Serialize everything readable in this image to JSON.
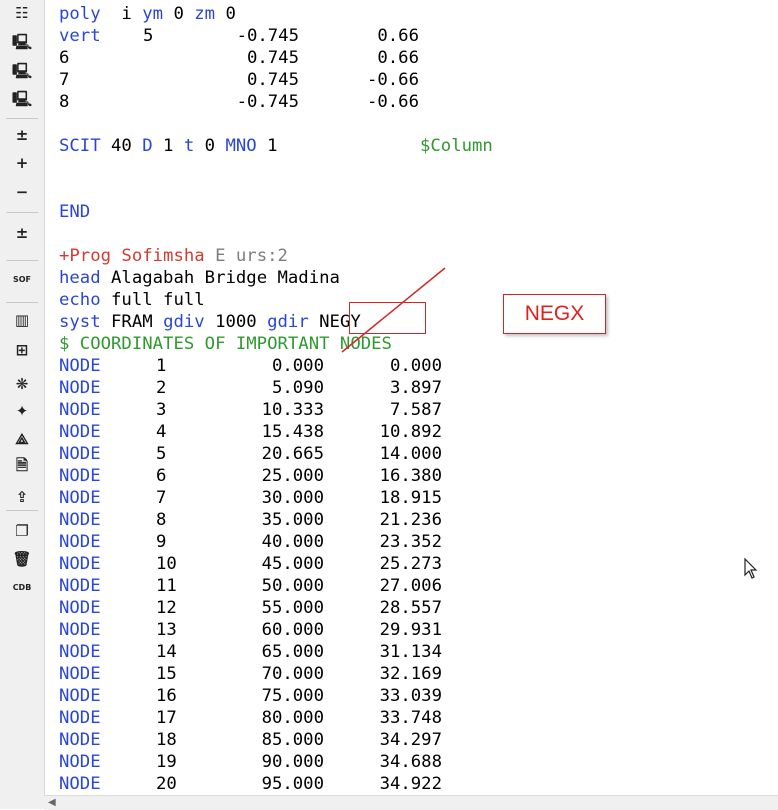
{
  "toolbar": {
    "buttons": [
      {
        "name": "list-view-icon",
        "glyph": "☷"
      },
      {
        "name": "computer-icon",
        "glyph": "🖳"
      },
      {
        "name": "computer-run-icon",
        "glyph": "🖳"
      },
      {
        "name": "computer-export-icon",
        "glyph": "🖳"
      },
      {
        "name": "plus-minus-icon",
        "glyph": "±"
      },
      {
        "name": "plus-icon",
        "glyph": "+"
      },
      {
        "name": "minus-icon",
        "glyph": "−"
      },
      {
        "name": "plus-minus-dropdown-icon",
        "glyph": "±"
      },
      {
        "name": "sofistik-icon",
        "glyph": "SOF"
      },
      {
        "name": "table-icon",
        "glyph": "▥"
      },
      {
        "name": "bridge-icon",
        "glyph": "⊞"
      },
      {
        "name": "butterfly-icon",
        "glyph": "❋"
      },
      {
        "name": "bat-icon",
        "glyph": "✦"
      },
      {
        "name": "structure-icon",
        "glyph": "⟁"
      },
      {
        "name": "document-icon",
        "glyph": "🗎"
      },
      {
        "name": "upload-icon",
        "glyph": "⇪"
      },
      {
        "name": "copy-icon",
        "glyph": "❐"
      },
      {
        "name": "trash-icon",
        "glyph": "🗑"
      },
      {
        "name": "cdb-icon",
        "glyph": "CDB"
      }
    ]
  },
  "code": {
    "poly": {
      "kw": "poly",
      "rest": "  i ",
      "ym": "ym",
      "mid": " 0 ",
      "zm": "zm",
      "end": " 0"
    },
    "vert": [
      {
        "label": "vert",
        "id": "5",
        "y": "-0.745",
        "z": "0.66"
      },
      {
        "label": "6",
        "id": "",
        "y": "0.745",
        "z": "0.66"
      },
      {
        "label": "7",
        "id": "",
        "y": "0.745",
        "z": "-0.66"
      },
      {
        "label": "8",
        "id": "",
        "y": "-0.745",
        "z": "-0.66"
      }
    ],
    "scit": {
      "kw": "SCIT",
      "v1": " 40 ",
      "d": "D",
      "v2": " 1 ",
      "t": "t",
      "v3": " 0 ",
      "mno": "MNO",
      "v4": " 1",
      "comment": "$Column"
    },
    "end": "END",
    "prog": {
      "kw": "+Prog Sofimsha",
      "rest": " E urs:2"
    },
    "head": {
      "kw": "head",
      "text": " Alagabah Bridge Madina"
    },
    "echo": {
      "kw": "echo",
      "text": " full full"
    },
    "syst": {
      "kw": "syst",
      "t1": " FRAM ",
      "gdiv": "gdiv",
      "t2": " 1000 ",
      "gdir": "gdir",
      "t3": " NEGY"
    },
    "comment": "$ COORDINATES OF IMPORTANT NODES",
    "node_kw": "NODE",
    "nodes": [
      {
        "n": "1",
        "x": "0.000",
        "y": "0.000"
      },
      {
        "n": "2",
        "x": "5.090",
        "y": "3.897"
      },
      {
        "n": "3",
        "x": "10.333",
        "y": "7.587"
      },
      {
        "n": "4",
        "x": "15.438",
        "y": "10.892"
      },
      {
        "n": "5",
        "x": "20.665",
        "y": "14.000"
      },
      {
        "n": "6",
        "x": "25.000",
        "y": "16.380"
      },
      {
        "n": "7",
        "x": "30.000",
        "y": "18.915"
      },
      {
        "n": "8",
        "x": "35.000",
        "y": "21.236"
      },
      {
        "n": "9",
        "x": "40.000",
        "y": "23.352"
      },
      {
        "n": "10",
        "x": "45.000",
        "y": "25.273"
      },
      {
        "n": "11",
        "x": "50.000",
        "y": "27.006"
      },
      {
        "n": "12",
        "x": "55.000",
        "y": "28.557"
      },
      {
        "n": "13",
        "x": "60.000",
        "y": "29.931"
      },
      {
        "n": "14",
        "x": "65.000",
        "y": "31.134"
      },
      {
        "n": "15",
        "x": "70.000",
        "y": "32.169"
      },
      {
        "n": "16",
        "x": "75.000",
        "y": "33.039"
      },
      {
        "n": "17",
        "x": "80.000",
        "y": "33.748"
      },
      {
        "n": "18",
        "x": "85.000",
        "y": "34.297"
      },
      {
        "n": "19",
        "x": "90.000",
        "y": "34.688"
      },
      {
        "n": "20",
        "x": "95.000",
        "y": "34.922"
      }
    ]
  },
  "annotation": {
    "callout": "NEGX",
    "color": "#d32626"
  },
  "colors": {
    "keyword": "#2a46d6",
    "comment": "#2f9a2f",
    "prog": "#d43b2f",
    "gray": "#7d7d7d"
  }
}
